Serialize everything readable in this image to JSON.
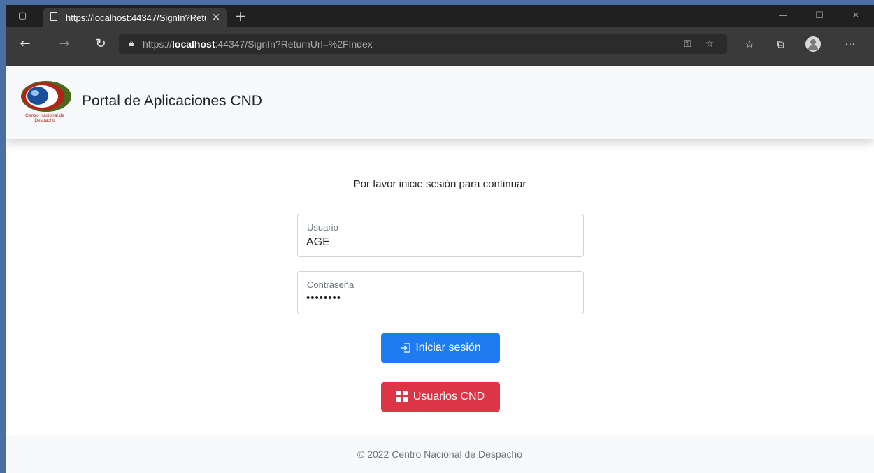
{
  "browser": {
    "tab_title": "https://localhost:44347/SignIn?ReturnUrl=%2FIndex",
    "url_prefix": "https://",
    "url_host": "localhost",
    "url_rest": ":44347/SignIn?ReturnUrl=%2FIndex"
  },
  "site": {
    "title": "Portal de Aplicaciones CND",
    "logo_text": "Centro Nacional de Despacho"
  },
  "login": {
    "prompt": "Por favor inicie sesión para continuar",
    "username_label": "Usuario",
    "username_value": "AGE",
    "password_label": "Contraseña",
    "password_value": "••••••••",
    "signin_label": "Iniciar sesión",
    "cnd_users_label": "Usuarios CND"
  },
  "footer": {
    "text": "© 2022 Centro Nacional de Despacho"
  },
  "colors": {
    "primary": "#1f7bf0",
    "danger": "#dc3545",
    "logo_red": "#b32318",
    "logo_green": "#4a6b1c"
  }
}
